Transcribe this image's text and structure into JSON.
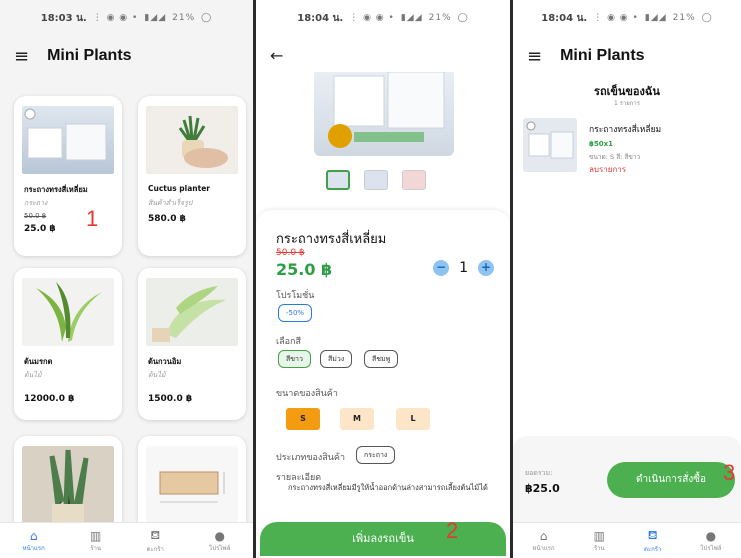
{
  "colors": {
    "accent_green": "#4caf50",
    "price_green": "#2e9e44",
    "accent_blue": "#2a7be0",
    "orange": "#f39c12",
    "red": "#e53935"
  },
  "screen1": {
    "status": {
      "time": "18:03 น.",
      "battery": "21%"
    },
    "title": "Mini Plants",
    "products": [
      {
        "name": "กระถางทรงสี่เหลี่ยม",
        "category": "กระถาง",
        "old_price": "50.0 ฿",
        "price": "25.0 ฿"
      },
      {
        "name": "Cuctus planter",
        "category": "สินค้าสำเร็จรูป",
        "price": "580.0 ฿"
      },
      {
        "name": "ต้นมรกต",
        "category": "ต้นไม้",
        "price": "12000.0 ฿"
      },
      {
        "name": "ต้นกวนอิม",
        "category": "ต้นไม้",
        "price": "1500.0 ฿"
      }
    ],
    "marker": "1",
    "nav": [
      "หน้าแรก",
      "ร้าน",
      "ตะกร้า",
      "โปรไฟล์"
    ]
  },
  "screen2": {
    "status": {
      "time": "18:04 น.",
      "battery": "21%"
    },
    "product_name": "กระถางทรงสี่เหลี่ยม",
    "old_price": "50.0 ฿",
    "price": "25.0 ฿",
    "quantity": "1",
    "promo_label": "โปรโมชั่น",
    "promo_value": "-50%",
    "color_label": "เลือกสี",
    "colors": [
      "สีขาว",
      "สีม่วง",
      "สีชมพู"
    ],
    "size_label": "ขนาดของสินค้า",
    "sizes": [
      "S",
      "M",
      "L"
    ],
    "type_label": "ประเภทของสินค้า",
    "type_value": "กระถาง",
    "detail_label": "รายละเอียด",
    "detail_text": "กระถางทรงสี่เหลี่ยมมีรูให้น้ำออกด้านล่างสามารถเลี้ยงต้นไม้ได้",
    "add_to_cart": "เพิ่มลงรถเข็น",
    "marker": "2"
  },
  "screen3": {
    "status": {
      "time": "18:04 น.",
      "battery": "21%"
    },
    "title": "Mini Plants",
    "cart_title": "รถเข็นของฉัน",
    "cart_count": "1 รายการ",
    "item": {
      "name": "กระถางทรงสี่เหลี่ยม",
      "price_qty": "฿50x1",
      "variant": "ขนาด: S  สี: สีขาว",
      "remove": "ลบรายการ"
    },
    "total_label": "ยอดรวม:",
    "total": "฿25.0",
    "checkout": "ดำเนินการสั่งซื้อ",
    "marker": "3",
    "nav": [
      "หน้าแรก",
      "ร้าน",
      "ตะกร้า",
      "โปรไฟล์"
    ]
  }
}
